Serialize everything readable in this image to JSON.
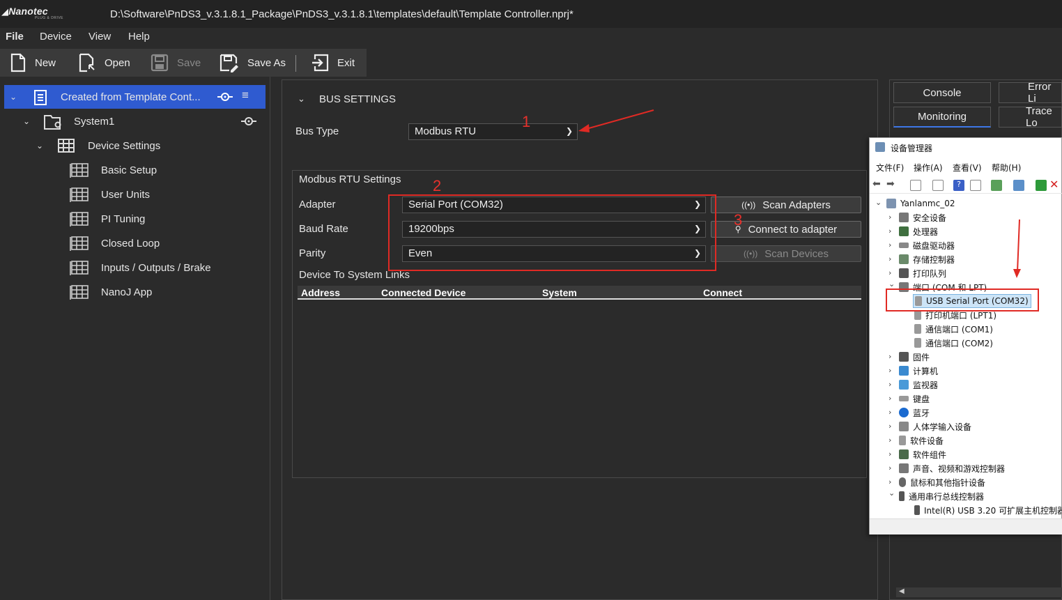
{
  "window": {
    "logo": "Nanotec",
    "logo_sub": "PLUG & DRIVE",
    "title": "D:\\Software\\PnDS3_v.3.1.8.1_Package\\PnDS3_v.3.1.8.1\\templates\\default\\Template Controller.nprj*"
  },
  "menu": {
    "file": "File",
    "device": "Device",
    "view": "View",
    "help": "Help"
  },
  "toolbar": {
    "new": "New",
    "open": "Open",
    "save": "Save",
    "save_as": "Save As",
    "exit": "Exit"
  },
  "tree": {
    "project": "Created from Template Cont...",
    "system": "System1",
    "device_settings": "Device Settings",
    "items": [
      "Basic Setup",
      "User Units",
      "PI Tuning",
      "Closed Loop",
      "Inputs / Outputs / Brake",
      "NanoJ App"
    ]
  },
  "bus": {
    "section_title": "BUS SETTINGS",
    "bus_type_label": "Bus Type",
    "bus_type_value": "Modbus RTU",
    "rtu_title": "Modbus RTU Settings",
    "adapter_label": "Adapter",
    "adapter_value": "Serial Port (COM32)",
    "baud_label": "Baud Rate",
    "baud_value": "19200bps",
    "parity_label": "Parity",
    "parity_value": "Even",
    "scan_adapters": "Scan Adapters",
    "connect_adapter": "Connect to adapter",
    "scan_devices": "Scan Devices",
    "links_title": "Device To System Links",
    "columns": [
      "Address",
      "Connected Device",
      "System",
      "Connect"
    ]
  },
  "right_tabs": {
    "console": "Console",
    "error": "Error Li",
    "monitoring": "Monitoring",
    "trace": "Trace Lo"
  },
  "device_manager": {
    "title": "设备管理器",
    "menus": [
      "文件(F)",
      "操作(A)",
      "查看(V)",
      "帮助(H)"
    ],
    "root": "Yanlanmc_02",
    "nodes": [
      "安全设备",
      "处理器",
      "磁盘驱动器",
      "存储控制器",
      "打印队列",
      "端口 (COM 和 LPT)"
    ],
    "ports": [
      "USB Serial Port (COM32)",
      "打印机端口 (LPT1)",
      "通信端口 (COM1)",
      "通信端口 (COM2)"
    ],
    "nodes2": [
      "固件",
      "计算机",
      "监视器",
      "键盘",
      "蓝牙",
      "人体学输入设备",
      "软件设备",
      "软件组件",
      "声音、视频和游戏控制器",
      "鼠标和其他指针设备",
      "通用串行总线控制器"
    ],
    "usb_child": "Intel(R) USB 3.20 可扩展主机控制器"
  },
  "annotations": {
    "n1": "1",
    "n2": "2",
    "n3": "3"
  },
  "colors": {
    "selected": "#2f5bd0",
    "accent": "#3d77e8",
    "annotation_red": "#e02a24"
  }
}
